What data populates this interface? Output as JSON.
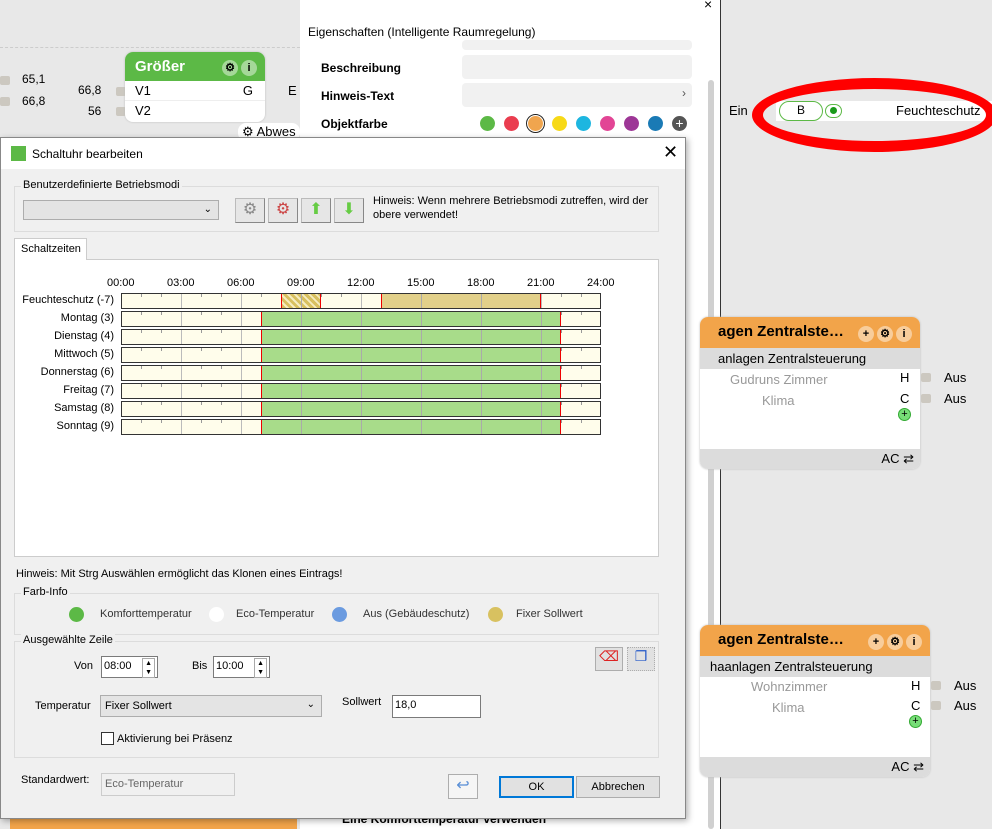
{
  "canvas": {
    "values_left": [
      "65,1",
      "66,8",
      "66,8",
      "56"
    ],
    "groesser": {
      "title": "Größer",
      "in1": "V1",
      "in2": "V2",
      "out": "G",
      "out_tail": "E",
      "gear": "⚙",
      "info": "i"
    },
    "abwesend_label": "Abwes",
    "feuchteschutz_node": {
      "in_label": "Ein",
      "badge": "B",
      "name": "Feuchteschutz"
    },
    "zentral1": {
      "title": "agen  Zentralste…",
      "subtitle": "anlagen Zentralsteuerung",
      "room": "Gudruns Zimmer",
      "klima": "Klima",
      "h": "H",
      "c": "C",
      "aus1": "Aus",
      "aus2": "Aus",
      "ac": "AC ⇄"
    },
    "zentral2": {
      "title": "agen  Zentralste…",
      "subtitle": "haanlagen Zentralsteuerung",
      "room": "Wohnzimmer",
      "klima": "Klima",
      "h": "H",
      "c": "C",
      "aus1": "Aus",
      "aus2": "Aus",
      "ac": "AC ⇄"
    }
  },
  "properties": {
    "title": "Eigenschaften (Intelligente Raumregelung)",
    "beschreibung": "Beschreibung",
    "hinweis_text": "Hinweis-Text",
    "objektfarbe": "Objektfarbe",
    "colors": [
      "#5cb946",
      "#ea3d4f",
      "#f0a54e",
      "#f7d917",
      "#1db6e0",
      "#e24595",
      "#9d3696",
      "#1a7ab5"
    ],
    "selected_color": "#f0a54e",
    "bottom_hint": "Eine Komforttemperatur verwenden"
  },
  "dialog": {
    "title": "Schaltuhr bearbeiten",
    "modes_group": "Benutzerdefinierte Betriebsmodi",
    "modes_hint": "Hinweis: Wenn mehrere Betriebsmodi zutreffen, wird der obere verwendet!",
    "tab": "Schaltzeiten",
    "clone_hint": "Hinweis: Mit Strg Auswählen ermöglicht das Klonen eines Eintrags!",
    "farbinfo": "Farb-Info",
    "legend": [
      {
        "label": "Komforttemperatur",
        "color": "#5cb946"
      },
      {
        "label": "Eco-Temperatur",
        "color": "#ffffff"
      },
      {
        "label": "Aus (Gebäudeschutz)",
        "color": "#6b9be0"
      },
      {
        "label": "Fixer Sollwert",
        "color": "#d8c160"
      }
    ],
    "selected_row": "Ausgewählte Zeile",
    "von_label": "Von",
    "von": "08:00",
    "bis_label": "Bis",
    "bis": "10:00",
    "temp_label": "Temperatur",
    "temp": "Fixer Sollwert",
    "sollwert_label": "Sollwert",
    "sollwert": "18,0",
    "presence": "Aktivierung bei Präsenz",
    "presence_checked": false,
    "standard_label": "Standardwert:",
    "standard": "Eco-Temperatur",
    "ok": "OK",
    "cancel": "Abbrechen"
  },
  "chart_data": {
    "type": "table",
    "x_ticks": [
      "00:00",
      "03:00",
      "06:00",
      "09:00",
      "12:00",
      "15:00",
      "18:00",
      "21:00",
      "24:00"
    ],
    "xlim": [
      0,
      24
    ],
    "rows": [
      {
        "label": "Feuchteschutz (-7)",
        "segments": [
          {
            "from": 8,
            "to": 10,
            "mode": "fixed",
            "selected": true
          },
          {
            "from": 13,
            "to": 21,
            "mode": "fixed"
          }
        ]
      },
      {
        "label": "Montag (3)",
        "segments": [
          {
            "from": 7,
            "to": 22,
            "mode": "comfort"
          }
        ]
      },
      {
        "label": "Dienstag (4)",
        "segments": [
          {
            "from": 7,
            "to": 22,
            "mode": "comfort"
          }
        ]
      },
      {
        "label": "Mittwoch (5)",
        "segments": [
          {
            "from": 7,
            "to": 22,
            "mode": "comfort"
          }
        ]
      },
      {
        "label": "Donnerstag (6)",
        "segments": [
          {
            "from": 7,
            "to": 22,
            "mode": "comfort"
          }
        ]
      },
      {
        "label": "Freitag (7)",
        "segments": [
          {
            "from": 7,
            "to": 22,
            "mode": "comfort"
          }
        ]
      },
      {
        "label": "Samstag (8)",
        "segments": [
          {
            "from": 7,
            "to": 22,
            "mode": "comfort"
          }
        ]
      },
      {
        "label": "Sonntag (9)",
        "segments": [
          {
            "from": 7,
            "to": 22,
            "mode": "comfort"
          }
        ]
      }
    ],
    "mode_colors": {
      "comfort": "#a8dc8a",
      "fixed": "#e2d08a"
    }
  }
}
